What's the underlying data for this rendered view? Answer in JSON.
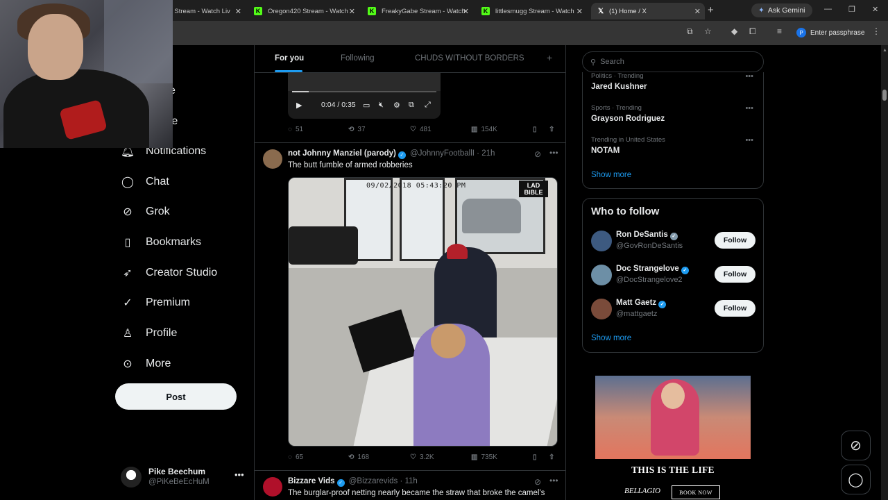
{
  "browser": {
    "tabs": [
      {
        "label": "y Stream - Watch Liv",
        "icon": "kick-icon",
        "active": false
      },
      {
        "label": "Oregon420 Stream - Watch",
        "icon": "kick-icon",
        "active": false
      },
      {
        "label": "FreakyGabe Stream - Watch",
        "icon": "kick-icon",
        "active": false
      },
      {
        "label": "littlesmugg Stream - Watch",
        "icon": "kick-icon",
        "active": false
      },
      {
        "label": "(1) Home / X",
        "icon": "x-icon",
        "active": true
      }
    ],
    "ask_gemini": "Ask Gemini",
    "passphrase": "Enter passphrase",
    "profile_initial": "P"
  },
  "nav": {
    "partial_items": [
      "e",
      "re"
    ],
    "items": [
      {
        "label": "Notifications",
        "icon": "bell-icon"
      },
      {
        "label": "Chat",
        "icon": "chat-icon"
      },
      {
        "label": "Grok",
        "icon": "grok-icon"
      },
      {
        "label": "Bookmarks",
        "icon": "bookmark-icon"
      },
      {
        "label": "Creator Studio",
        "icon": "rocket-icon"
      },
      {
        "label": "Premium",
        "icon": "premium-icon"
      },
      {
        "label": "Profile",
        "icon": "person-icon"
      },
      {
        "label": "More",
        "icon": "more-circle-icon"
      }
    ],
    "post_label": "Post",
    "account": {
      "name": "Pike Beechum",
      "handle": "@PiKeBeEcHuM"
    }
  },
  "timeline": {
    "tabs": [
      {
        "label": "For you",
        "active": true
      },
      {
        "label": "Following",
        "active": false
      },
      {
        "label": "CHUDS WITHOUT BORDERS",
        "active": false
      }
    ],
    "video": {
      "time": "0:04 / 0:35",
      "progress": 0.114
    },
    "tweet0_stats": {
      "replies": "51",
      "reposts": "37",
      "likes": "481",
      "views": "154K"
    },
    "tweet1": {
      "name": "not Johnny Manziel (parody)",
      "handle": "@JohnnyFootballI",
      "time": "· 21h",
      "text": "The butt fumble of armed robberies",
      "media_timestamp": "09/02/2018 05:43:20 PM",
      "media_badge": "LAD BIBLE",
      "stats": {
        "replies": "65",
        "reposts": "168",
        "likes": "3.2K",
        "views": "735K"
      }
    },
    "tweet2": {
      "name": "Bizzare Vids",
      "handle": "@Bizzarevids",
      "time": "· 11h",
      "text": "The burglar-proof netting nearly became the straw that broke the camel's"
    }
  },
  "sidebar": {
    "search_placeholder": "Search",
    "trends": [
      {
        "context": "Politics · Trending",
        "title": "Jared Kushner"
      },
      {
        "context": "Sports · Trending",
        "title": "Grayson Rodriguez"
      },
      {
        "context": "Trending in United States",
        "title": "NOTAM"
      }
    ],
    "trends_show_more": "Show more",
    "who_to_follow": {
      "title": "Who to follow",
      "people": [
        {
          "name": "Ron DeSantis",
          "handle": "@GovRonDeSantis",
          "badge": "gray"
        },
        {
          "name": "Doc Strangelove",
          "handle": "@DocStrangelove2",
          "badge": "blue"
        },
        {
          "name": "Matt Gaetz",
          "handle": "@mattgaetz",
          "badge": "blue"
        }
      ],
      "follow_label": "Follow",
      "show_more": "Show more"
    },
    "ad": {
      "headline": "THIS IS THE LIFE",
      "brand": "BELLAGIO",
      "cta": "BOOK NOW"
    }
  },
  "colors": {
    "accent": "#1d9bf0",
    "background": "#000000",
    "muted": "#71767b"
  }
}
